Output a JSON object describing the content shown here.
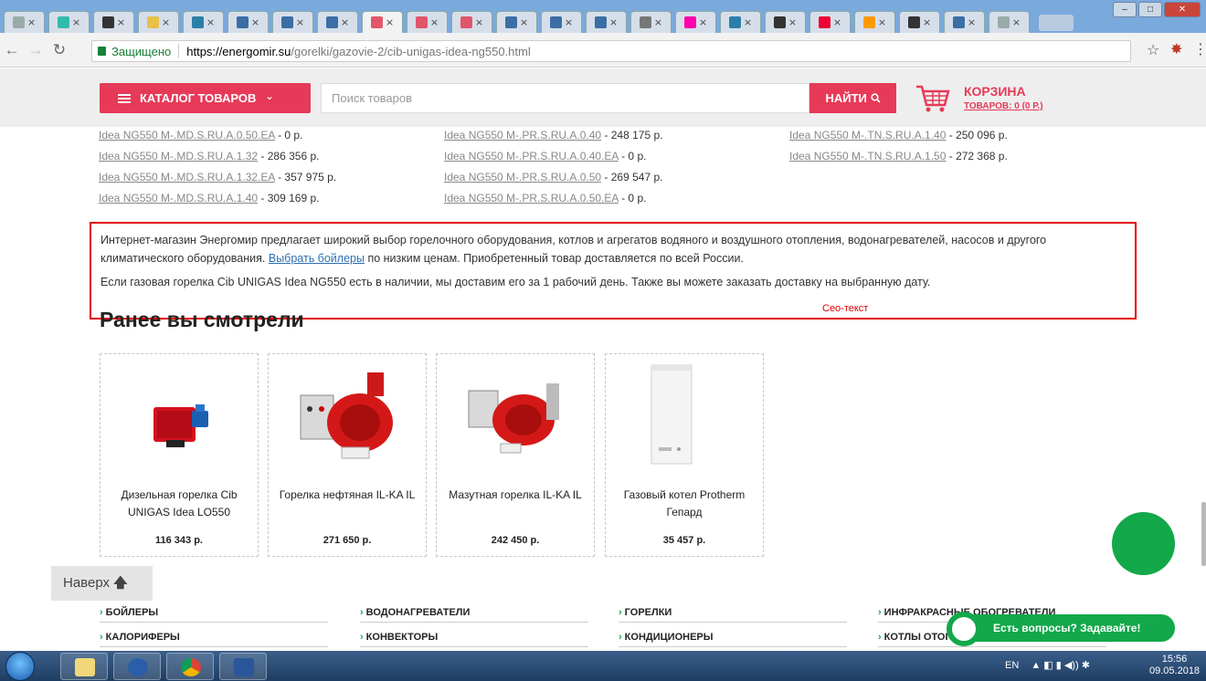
{
  "browser": {
    "tab_favicons": [
      "#9aa",
      "#3ba",
      "#333",
      "#e9c04a",
      "#2a7fa8",
      "#3b6ea5",
      "#3b6ea5",
      "#3b6ea5",
      "#e0566b",
      "#e0566b",
      "#e0566b",
      "#3b6ea5",
      "#3b6ea5",
      "#3b6ea5",
      "#777",
      "#f0a",
      "#2a7fa8",
      "#333",
      "#e03",
      "#f90",
      "#333",
      "#3b6ea5",
      "#9aa"
    ],
    "tab_close": "×",
    "secure_label": "Защищено",
    "url_domain": "https://energomir.su",
    "url_path": "/gorelki/gazovie-2/cib-unigas-idea-ng550.html"
  },
  "header": {
    "catalog_label": "КАТАЛОГ ТОВАРОВ",
    "catalog_chevron": "⌄",
    "search_placeholder": "Поиск товаров",
    "search_button": "НАЙТИ",
    "search_icon": "search-icon",
    "cart_title": "КОРЗИНА",
    "cart_sub": "ТОВАРОВ: 0 (0 Р.)",
    "accent_color": "#e63a58"
  },
  "product_links": {
    "col1": [
      {
        "name": "Idea NG550 M-.MD.S.RU.A.0.50.EA",
        "price": " - 0 р."
      },
      {
        "name": "Idea NG550 M-.MD.S.RU.A.1.32",
        "price": " - 286 356 р."
      },
      {
        "name": "Idea NG550 M-.MD.S.RU.A.1.32.EA",
        "price": " - 357 975 р."
      },
      {
        "name": "Idea NG550 M-.MD.S.RU.A.1.40",
        "price": " - 309 169 р."
      }
    ],
    "col2": [
      {
        "name": "Idea NG550 M-.PR.S.RU.A.0.40",
        "price": " - 248 175 р."
      },
      {
        "name": "Idea NG550 M-.PR.S.RU.A.0.40.EA",
        "price": " - 0 р."
      },
      {
        "name": "Idea NG550 M-.PR.S.RU.A.0.50",
        "price": " - 269 547 р."
      },
      {
        "name": "Idea NG550 M-.PR.S.RU.A.0.50.EA",
        "price": " - 0 р."
      }
    ],
    "col3": [
      {
        "name": "Idea NG550 M-.TN.S.RU.A.1.40",
        "price": " - 250 096 р."
      },
      {
        "name": "Idea NG550 M-.TN.S.RU.A.1.50",
        "price": " - 272 368 р."
      }
    ]
  },
  "seo": {
    "p1_start": "Интернет-магазин Энергомир предлагает широкий выбор горелочного оборудования, котлов и агрегатов водяного и воздушного отопления, водонагревателей, насосов и другого климатического оборудования. ",
    "p1_link": "Выбрать бойлеры",
    "p1_end": " по низким ценам. Приобретенный товар доставляется по всей России.",
    "p2": "Если газовая горелка Cib UNIGAS Idea NG550 есть в наличии, мы доставим его за 1 рабочий день. Также вы можете заказать доставку на выбранную дату.",
    "label": "Сео-текст"
  },
  "recent": {
    "title": "Ранее вы смотрели",
    "items": [
      {
        "name": "Дизельная горелка Cib UNIGAS Idea LO550",
        "price": "116 343 р."
      },
      {
        "name": "Горелка нефтяная IL-KA IL",
        "price": "271 650 р."
      },
      {
        "name": "Мазутная горелка IL-KA IL",
        "price": "242 450 р."
      },
      {
        "name": "Газовый котел Protherm Гепард",
        "price": "35 457 р."
      }
    ]
  },
  "to_top": {
    "label": "Наверх",
    "arrow": "🡅"
  },
  "footer": {
    "row1": [
      "БОЙЛЕРЫ",
      "ВОДОНАГРЕВАТЕЛИ",
      "ГОРЕЛКИ",
      "ИНФРАКРАСНЫЕ ОБОГРЕВАТЕЛИ"
    ],
    "row2": [
      "КАЛОРИФЕРЫ",
      "КОНВЕКТОРЫ",
      "КОНДИЦИОНЕРЫ",
      "КОТЛЫ ОТОПЛЕНИЯ"
    ],
    "chevron": "›",
    "brand_green": "#13a84a"
  },
  "chat": {
    "label": "Есть вопросы? Задавайте!"
  },
  "taskbar": {
    "lang": "EN",
    "time": "15:56",
    "date": "09.05.2018"
  }
}
